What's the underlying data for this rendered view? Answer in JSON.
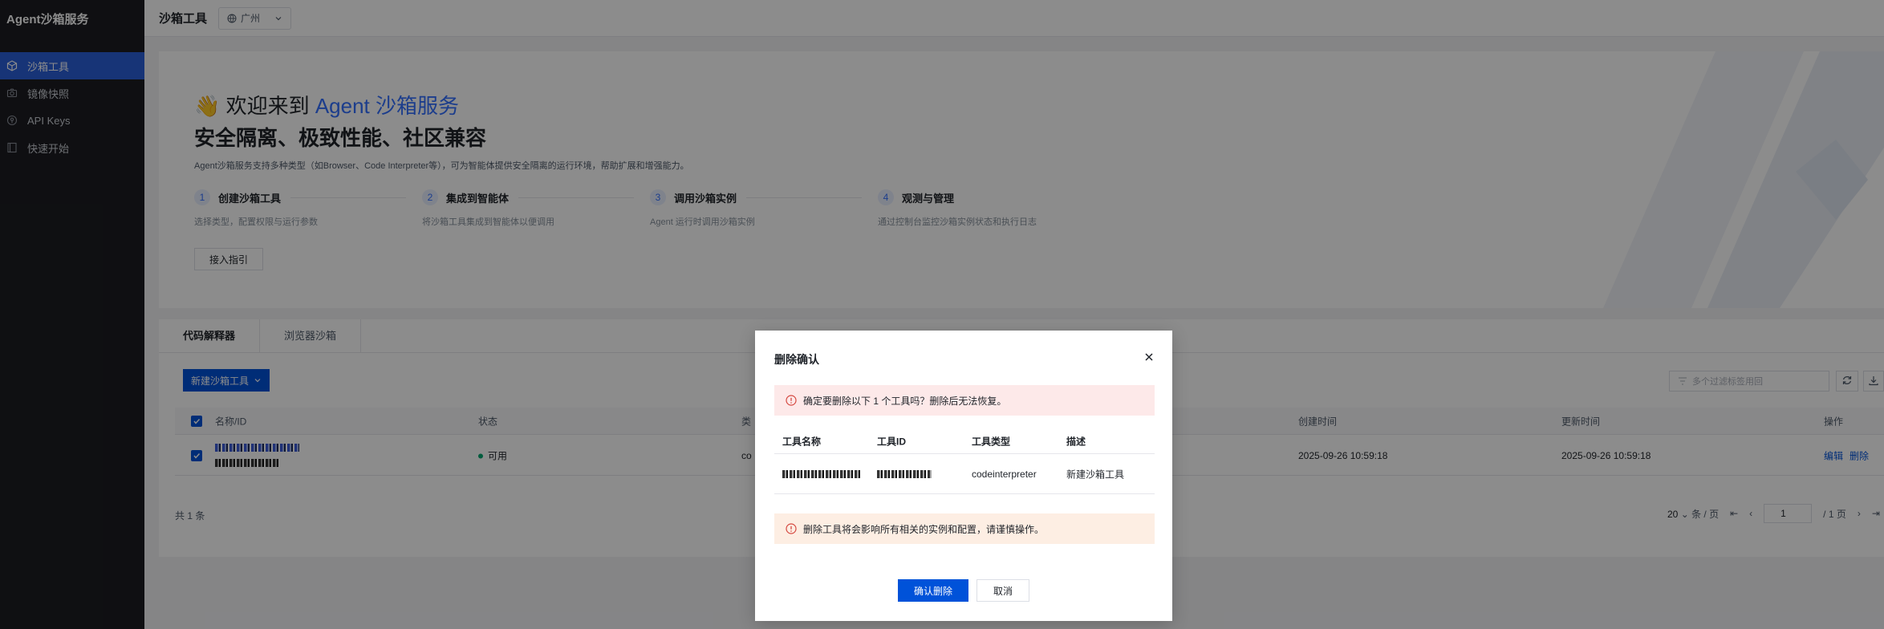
{
  "app": {
    "brand": "Agent沙箱服务"
  },
  "sidebar": {
    "items": [
      {
        "label": "沙箱工具",
        "icon": "cube-icon",
        "active": true
      },
      {
        "label": "镜像快照",
        "icon": "camera-icon",
        "active": false
      },
      {
        "label": "API Keys",
        "icon": "key-icon",
        "active": false
      },
      {
        "label": "快速开始",
        "icon": "book-icon",
        "active": false
      }
    ]
  },
  "header": {
    "title": "沙箱工具",
    "region": "广州"
  },
  "banner": {
    "welcome_prefix": "👋 欢迎来到 ",
    "welcome_highlight": "Agent 沙箱服务",
    "slogan": "安全隔离、极致性能、社区兼容",
    "intro": "Agent沙箱服务支持多种类型（如Browser、Code Interpreter等），可为智能体提供安全隔离的运行环境，帮助扩展和增强能力。",
    "steps": [
      {
        "num": "1",
        "title": "创建沙箱工具",
        "desc": "选择类型，配置权限与运行参数"
      },
      {
        "num": "2",
        "title": "集成到智能体",
        "desc": "将沙箱工具集成到智能体以便调用"
      },
      {
        "num": "3",
        "title": "调用沙箱实例",
        "desc": "Agent 运行时调用沙箱实例"
      },
      {
        "num": "4",
        "title": "观测与管理",
        "desc": "通过控制台监控沙箱实例状态和执行日志"
      }
    ],
    "guide_button": "接入指引"
  },
  "tabs": [
    {
      "label": "代码解释器",
      "active": true
    },
    {
      "label": "浏览器沙箱",
      "active": false
    }
  ],
  "toolbar": {
    "new_button": "新建沙箱工具",
    "filter_placeholder": "多个过滤标签用回"
  },
  "table": {
    "columns": {
      "name": "名称/ID",
      "status": "状态",
      "type": "类",
      "created": "创建时间",
      "updated": "更新时间",
      "actions": "操作"
    },
    "rows": [
      {
        "status": "可用",
        "type": "co",
        "created": "2025-09-26 10:59:18",
        "updated": "2025-09-26 10:59:18",
        "edit": "编辑",
        "delete": "删除"
      }
    ],
    "total": "共 1 条"
  },
  "pager": {
    "page_size": "20",
    "per_page_suffix": "条 / 页",
    "current": "1",
    "total_pages": "/ 1 页"
  },
  "modal": {
    "title": "删除确认",
    "warning": "确定要删除以下 1 个工具吗？删除后无法恢复。",
    "columns": {
      "name": "工具名称",
      "id": "工具ID",
      "type": "工具类型",
      "desc": "描述"
    },
    "row": {
      "type": "codeinterpreter",
      "desc": "新建沙箱工具"
    },
    "caution": "删除工具将会影响所有相关的实例和配置，请谨慎操作。",
    "confirm": "确认删除",
    "cancel": "取消"
  },
  "colors": {
    "primary": "#0052d9",
    "accent": "#3370ff",
    "sidebar_bg": "#1c1d21",
    "success": "#00a870",
    "danger_bg": "#fde9e9",
    "warn_bg": "#fdeee3"
  }
}
